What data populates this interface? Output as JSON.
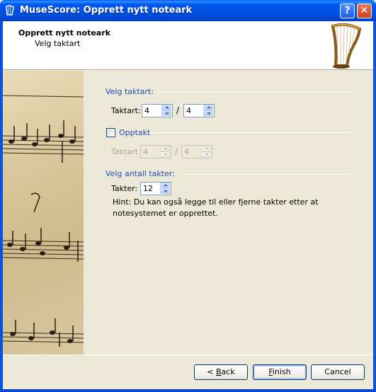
{
  "window": {
    "title": "MuseScore: Opprett nytt noteark",
    "help_label": "?",
    "close_label": "✕"
  },
  "header": {
    "title": "Opprett nytt noteark",
    "subtitle": "Velg taktart"
  },
  "time_signature": {
    "group_title": "Velg taktart:",
    "label": "Taktart:",
    "numerator": "4",
    "denominator": "4",
    "separator": "/"
  },
  "pickup": {
    "checkbox_label": "Opptakt",
    "checked": false,
    "label": "Taktart",
    "numerator": "4",
    "denominator": "4",
    "separator": "/"
  },
  "measures": {
    "group_title": "Velg antall takter:",
    "label": "Takter:",
    "value": "12",
    "hint": "Hint: Du kan også legge til eller fjerne takter etter at notesystemet er opprettet."
  },
  "buttons": {
    "back_prefix": "< ",
    "back_mnemonic": "B",
    "back_rest": "ack",
    "finish_mnemonic": "F",
    "finish_rest": "inish",
    "cancel": "Cancel"
  },
  "icons": {
    "title_icon": "musescore-harp-icon",
    "header_icon": "harp-icon",
    "side_image": "sheet-music-image"
  },
  "colors": {
    "titlebar": "#0058ee",
    "group_title": "#1e4fb8",
    "dialog_bg": "#ece9d8"
  }
}
